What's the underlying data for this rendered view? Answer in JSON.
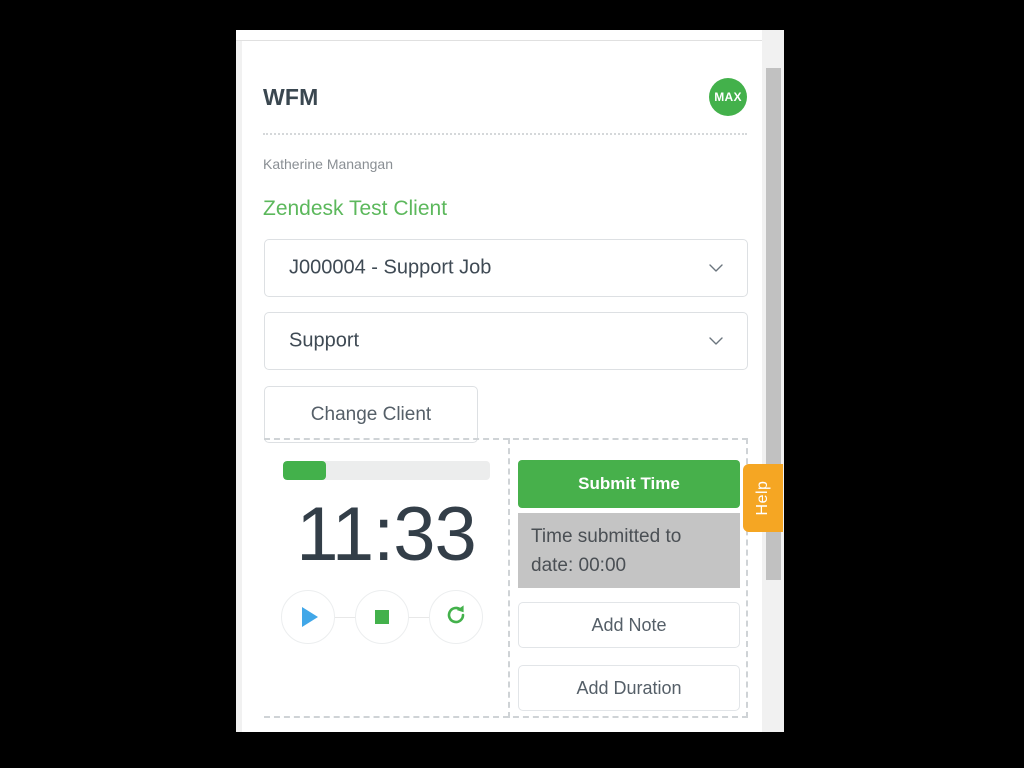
{
  "app": {
    "title": "WFM",
    "avatar_initials": "MAX"
  },
  "user": {
    "name": "Katherine Manangan",
    "client": "Zendesk Test Client"
  },
  "selects": {
    "job": {
      "value": "J000004 - Support Job",
      "chevron_icon": "chevron-down-icon"
    },
    "task": {
      "value": "Support",
      "chevron_icon": "chevron-down-icon"
    }
  },
  "buttons": {
    "change_client": "Change Client",
    "submit_time": "Submit Time",
    "add_note": "Add Note",
    "add_duration": "Add Duration"
  },
  "timer": {
    "elapsed": "11:33",
    "progress_percent": 21,
    "play_icon": "play-icon",
    "stop_icon": "stop-icon",
    "reset_icon": "reset-icon"
  },
  "status": {
    "time_submitted": "Time submitted to date: 00:00"
  },
  "help": {
    "label": "Help"
  },
  "colors": {
    "green_primary": "#43b14b",
    "green_submit": "#47b04b",
    "green_text": "#5cb85c",
    "blue_play": "#41a7e8",
    "orange_help": "#f5a623",
    "gray_status_box": "#c4c4c4",
    "text_dark": "#333e48"
  }
}
